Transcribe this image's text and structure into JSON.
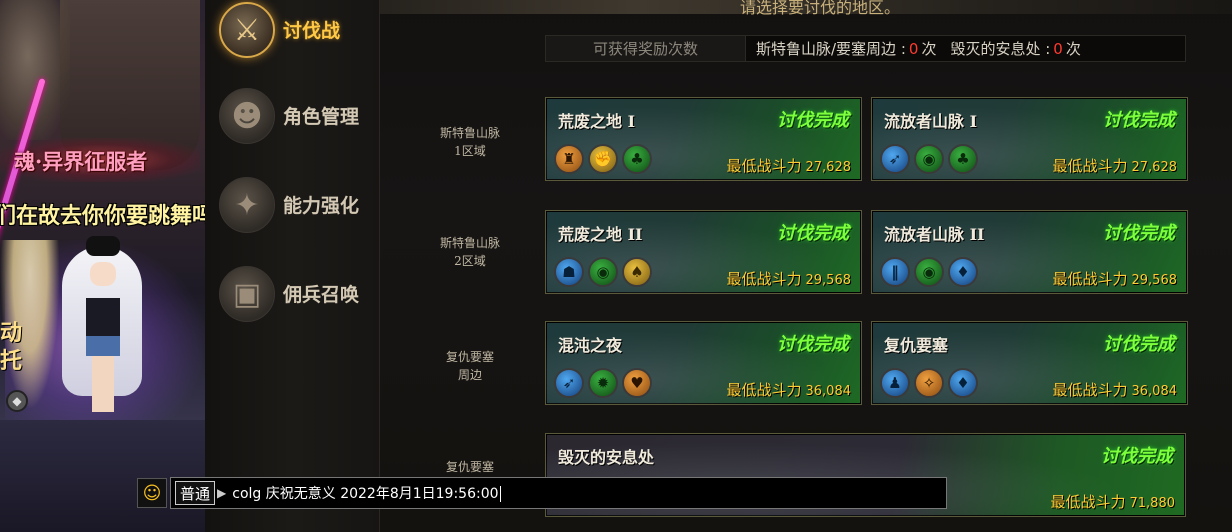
{
  "scene": {
    "player_title": "魂·异界征服者",
    "speech_bubble": "们在故去你你要跳舞吗",
    "side_text_1": "动",
    "side_text_2": "托"
  },
  "menu": {
    "items": [
      {
        "label": "讨伐战",
        "icon": "crossed-swords-icon",
        "active": true
      },
      {
        "label": "角色管理",
        "icon": "character-bust-icon",
        "active": false
      },
      {
        "label": "能力强化",
        "icon": "star-emblem-icon",
        "active": false
      },
      {
        "label": "佣兵召唤",
        "icon": "treasure-chest-icon",
        "active": false
      }
    ]
  },
  "main": {
    "top_hint": "请选择要讨伐的地区。",
    "reward_bar": {
      "label": "可获得奖励次数",
      "area1_name": "斯特鲁山脉/要塞周边 :",
      "area1_count": "0",
      "area2_name": "毁灭的安息处 :",
      "area2_count": "0",
      "unit": "次"
    },
    "regions": [
      {
        "line1": "斯特鲁山脉",
        "line2": "1区域"
      },
      {
        "line1": "斯特鲁山脉",
        "line2": "2区域"
      },
      {
        "line1": "复仇要塞",
        "line2": "周边"
      },
      {
        "line1": "复仇要塞",
        "line2": ""
      }
    ],
    "power_label": "最低战斗力",
    "cards": [
      {
        "name": "荒废之地 I",
        "status": "讨伐完成",
        "power": "27,628",
        "icons": [
          "orange",
          "gold",
          "green"
        ]
      },
      {
        "name": "流放者山脉 I",
        "status": "讨伐完成",
        "power": "27,628",
        "icons": [
          "blue",
          "green",
          "green"
        ]
      },
      {
        "name": "荒废之地 II",
        "status": "讨伐完成",
        "power": "29,568",
        "icons": [
          "blue",
          "green",
          "gold"
        ]
      },
      {
        "name": "流放者山脉 II",
        "status": "讨伐完成",
        "power": "29,568",
        "icons": [
          "blue",
          "green",
          "blue"
        ]
      },
      {
        "name": "混沌之夜",
        "status": "讨伐完成",
        "power": "36,084",
        "icons": [
          "blue",
          "green",
          "orange"
        ]
      },
      {
        "name": "复仇要塞",
        "status": "讨伐完成",
        "power": "36,084",
        "icons": [
          "blue",
          "orange",
          "blue"
        ]
      },
      {
        "name": "毁灭的安息处",
        "status": "讨伐完成",
        "power": "71,880",
        "icons": []
      }
    ]
  },
  "chat": {
    "channel": "普通",
    "message": "colg 庆祝无意义 2022年8月1日19:56:00"
  },
  "colors": {
    "status_green": "#7dff3c",
    "power_gold": "#ffcc33",
    "count_red": "#ff3b30",
    "menu_active": "#ffc845"
  }
}
